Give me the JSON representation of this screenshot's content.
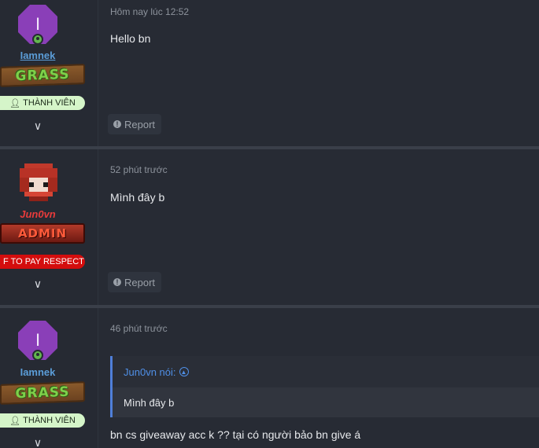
{
  "posts": [
    {
      "username": "Iamnek",
      "avatar_letter": "I",
      "avatar_color": "#8a3fb8",
      "rank_banner": "GRASS",
      "role_badge": "THÀNH VIÊN",
      "timestamp": "Hôm nay lúc 12:52",
      "content": "Hello bn",
      "report_label": "Report"
    },
    {
      "username": "Jun0vn",
      "rank_banner": "ADMIN",
      "role_badge": "F TO PAY RESPECT",
      "timestamp": "52 phút trước",
      "content": "Mình đây b",
      "report_label": "Report"
    },
    {
      "username": "Iamnek",
      "avatar_letter": "I",
      "avatar_color": "#8a3fb8",
      "rank_banner": "GRASS",
      "role_badge": "THÀNH VIÊN",
      "timestamp": "46 phút trước",
      "quote": {
        "author_line": "Jun0vn nói:",
        "text": "Mình đây b"
      },
      "content": "bn cs giveaway acc k ?? tại có người bảo bn give á"
    }
  ],
  "icons": {
    "chevron": "chevron-down-icon",
    "report": "info-circle-icon",
    "quote_jump": "arrow-up-circle-icon",
    "user": "user-icon",
    "online": "online-status-icon"
  },
  "colors": {
    "background": "#262a33",
    "member_name": "#5b9dd8",
    "admin_name": "#e83b3b",
    "member_badge": "#d5f5c9",
    "admin_badge": "#d40d0d",
    "quote_accent": "#4f7fd9"
  }
}
